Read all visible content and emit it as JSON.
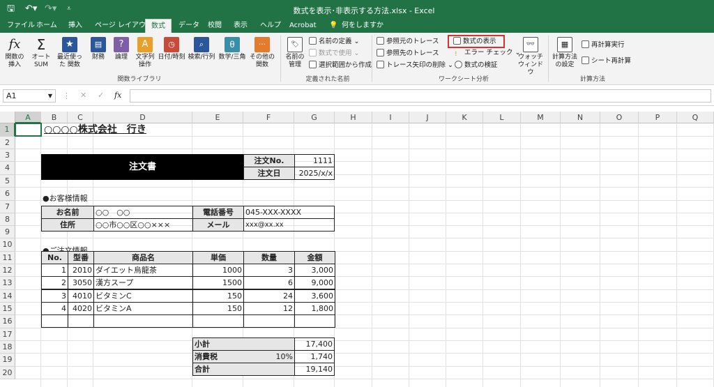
{
  "title_bar": {
    "doc_title": "数式を表示･非表示する方法.xlsx - Excel"
  },
  "tabs": [
    "ファイル",
    "ホーム",
    "挿入",
    "ページ レイアウト",
    "数式",
    "データ",
    "校閲",
    "表示",
    "ヘルプ",
    "Acrobat",
    "何をしますか"
  ],
  "ribbon": {
    "function_library": {
      "insert_fn": "関数の挿入",
      "autosum": "オート SUM",
      "recent": "最近使った 関数",
      "finance": "財務",
      "logic": "論理",
      "text": "文字列 操作",
      "datetime": "日付/時刻",
      "lookup": "検索/行列",
      "math": "数学/三角",
      "other": "その他の 関数",
      "group": "関数ライブラリ"
    },
    "defined_names": {
      "manager": "名前の管理",
      "define": "名前の定義",
      "use_in_formula": "数式で使用",
      "create_from_sel": "選択範囲から作成",
      "group": "定義された名前"
    },
    "formula_auditing": {
      "trace_prec": "参照元のトレース",
      "trace_dep": "参照先のトレース",
      "remove_arrows": "トレース矢印の削除",
      "show_formulas": "数式の表示",
      "error_check": "エラー チェック",
      "evaluate": "数式の検証",
      "watch": "ウォッチ ウィンドウ",
      "group": "ワークシート分析"
    },
    "calculation": {
      "options": "計算方法 の設定",
      "calc_now": "再計算実行",
      "calc_sheet": "シート再計算",
      "group": "計算方法"
    }
  },
  "formula_bar": {
    "name_box": "A1",
    "fx": "fx"
  },
  "columns": [
    "A",
    "B",
    "C",
    "D",
    "E",
    "F",
    "G",
    "H",
    "I",
    "J",
    "K",
    "L",
    "M",
    "N",
    "O",
    "P",
    "Q"
  ],
  "rows": [
    "1",
    "2",
    "3",
    "4",
    "5",
    "6",
    "7",
    "8",
    "9",
    "10",
    "11",
    "12",
    "13",
    "14",
    "15",
    "16",
    "17",
    "18",
    "19",
    "20"
  ],
  "sheet": {
    "title": "○○○○株式会社　行き",
    "order_form": "注文書",
    "order_no_label": "注文No.",
    "order_no": "1111",
    "order_date_label": "注文日",
    "order_date": "2025/x/x",
    "customer_header": "●お客様情報",
    "name_label": "お名前",
    "name_value": "○○　○○",
    "phone_label": "電話番号",
    "phone_value": "045-XXX-XXXX",
    "address_label": "住所",
    "address_value": "○○市○○区○○×××",
    "mail_label": "メール",
    "mail_value": "xxx@xx.xx",
    "order_header": "●ご注文情報",
    "headers": [
      "No.",
      "型番",
      "商品名",
      "単価",
      "数量",
      "金額"
    ],
    "items": [
      {
        "no": "1",
        "code": "2010",
        "name": "ダイエット烏龍茶",
        "price": "1000",
        "qty": "3",
        "amount": "3,000"
      },
      {
        "no": "2",
        "code": "3050",
        "name": "漢方スープ",
        "price": "1500",
        "qty": "6",
        "amount": "9,000"
      },
      {
        "no": "3",
        "code": "4010",
        "name": "ビタミンC",
        "price": "150",
        "qty": "24",
        "amount": "3,600"
      },
      {
        "no": "4",
        "code": "4020",
        "name": "ビタミンA",
        "price": "150",
        "qty": "12",
        "amount": "1,800"
      }
    ],
    "subtotal_label": "小計",
    "subtotal": "17,400",
    "tax_label": "消費税",
    "tax_rate": "10%",
    "tax": "1,740",
    "total_label": "合計",
    "total": "19,140"
  }
}
